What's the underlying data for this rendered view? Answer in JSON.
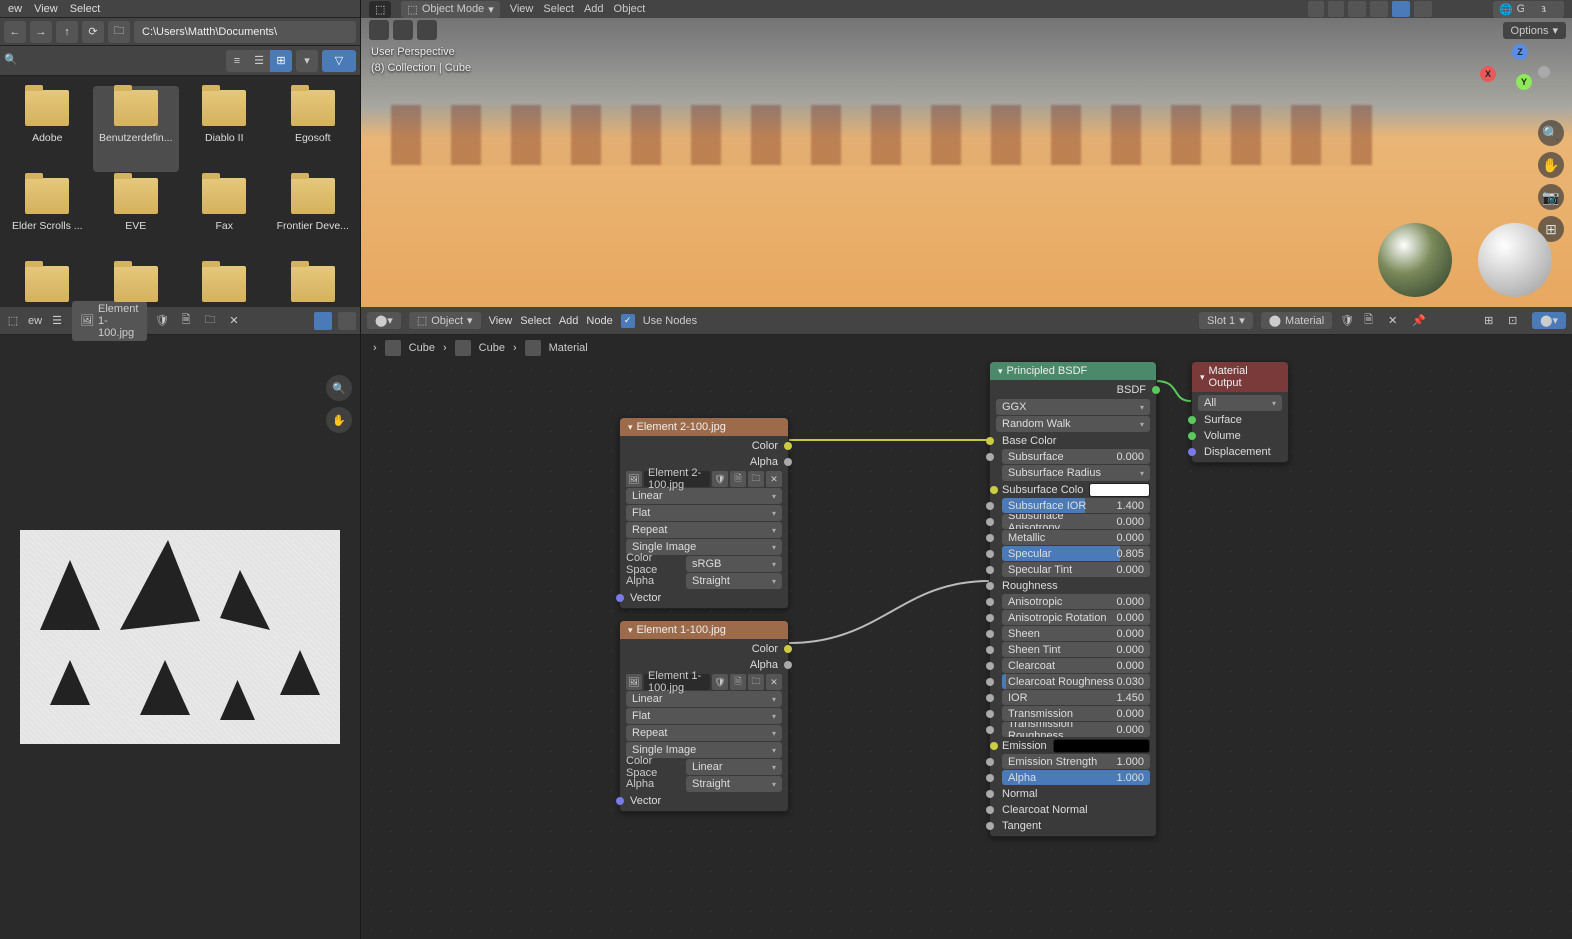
{
  "filebrowser": {
    "top_menu": [
      "ew",
      "View",
      "Select"
    ],
    "path": "C:\\Users\\Matth\\Documents\\",
    "items": [
      {
        "label": "Adobe"
      },
      {
        "label": "Benutzerdefin...",
        "sel": true
      },
      {
        "label": "Diablo II"
      },
      {
        "label": "Egosoft"
      },
      {
        "label": "Elder Scrolls ..."
      },
      {
        "label": "EVE"
      },
      {
        "label": "Fax"
      },
      {
        "label": "Frontier Deve..."
      },
      {
        "label": ""
      },
      {
        "label": ""
      },
      {
        "label": ""
      },
      {
        "label": ""
      }
    ]
  },
  "viewport": {
    "mode": "Object Mode",
    "menu": [
      "View",
      "Select",
      "Add",
      "Object"
    ],
    "global": "Global",
    "options": "Options",
    "info1": "User Perspective",
    "info2": "(8) Collection | Cube"
  },
  "image_editor": {
    "menu": [
      "ew"
    ],
    "image_name": "Element 1-100.jpg"
  },
  "node_editor": {
    "object_label": "Object",
    "menu": [
      "View",
      "Select",
      "Add",
      "Node"
    ],
    "use_nodes": "Use Nodes",
    "slot": "Slot 1",
    "material": "Material",
    "breadcrumb": [
      "Cube",
      "Cube",
      "Material"
    ]
  },
  "nodes": {
    "img1": {
      "title": "Element 2-100.jpg",
      "outputs": {
        "color": "Color",
        "alpha": "Alpha"
      },
      "file": "Element 2-100.jpg",
      "interp": "Linear",
      "proj": "Flat",
      "ext": "Repeat",
      "src": "Single Image",
      "cs_label": "Color Space",
      "cs": "sRGB",
      "alpha_label": "Alpha",
      "alpha_mode": "Straight",
      "vector": "Vector"
    },
    "img2": {
      "title": "Element 1-100.jpg",
      "outputs": {
        "color": "Color",
        "alpha": "Alpha"
      },
      "file": "Element 1-100.jpg",
      "interp": "Linear",
      "proj": "Flat",
      "ext": "Repeat",
      "src": "Single Image",
      "cs_label": "Color Space",
      "cs": "Linear",
      "alpha_label": "Alpha",
      "alpha_mode": "Straight",
      "vector": "Vector"
    },
    "bsdf": {
      "title": "Principled BSDF",
      "out": "BSDF",
      "dist": "GGX",
      "sss": "Random Walk",
      "base_color": "Base Color",
      "params": [
        {
          "l": "Subsurface",
          "v": "0.000",
          "fill": 0
        },
        {
          "l": "Subsurface Radius",
          "dd": true
        },
        {
          "l": "Subsurface Colo",
          "color": "#ffffff"
        },
        {
          "l": "Subsurface IOR",
          "v": "1.400",
          "fill": 56
        },
        {
          "l": "Subsurface Anisotropy",
          "v": "0.000",
          "fill": 0
        },
        {
          "l": "Metallic",
          "v": "0.000",
          "fill": 0
        },
        {
          "l": "Specular",
          "v": "0.805",
          "fill": 80
        },
        {
          "l": "Specular Tint",
          "v": "0.000",
          "fill": 0
        },
        {
          "l": "Roughness",
          "input": true
        },
        {
          "l": "Anisotropic",
          "v": "0.000",
          "fill": 0
        },
        {
          "l": "Anisotropic Rotation",
          "v": "0.000",
          "fill": 0
        },
        {
          "l": "Sheen",
          "v": "0.000",
          "fill": 0
        },
        {
          "l": "Sheen Tint",
          "v": "0.000",
          "fill": 0
        },
        {
          "l": "Clearcoat",
          "v": "0.000",
          "fill": 0
        },
        {
          "l": "Clearcoat Roughness",
          "v": "0.030",
          "fill": 3
        },
        {
          "l": "IOR",
          "v": "1.450",
          "fill": 0
        },
        {
          "l": "Transmission",
          "v": "0.000",
          "fill": 0
        },
        {
          "l": "Transmission Roughness",
          "v": "0.000",
          "fill": 0
        },
        {
          "l": "Emission",
          "color": "#000000"
        },
        {
          "l": "Emission Strength",
          "v": "1.000",
          "fill": 0
        },
        {
          "l": "Alpha",
          "v": "1.000",
          "fill": 100
        },
        {
          "l": "Normal",
          "input": true
        },
        {
          "l": "Clearcoat Normal",
          "input": true
        },
        {
          "l": "Tangent",
          "input": true
        }
      ]
    },
    "out": {
      "title": "Material Output",
      "target": "All",
      "inputs": [
        "Surface",
        "Volume",
        "Displacement"
      ]
    }
  }
}
